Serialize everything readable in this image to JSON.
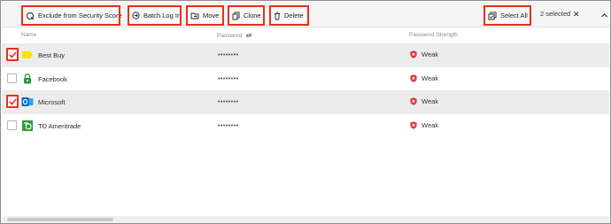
{
  "toolbar": {
    "exclude_label": "Exclude from Security Score",
    "batch_login_label": "Batch Log In",
    "move_label": "Move",
    "clone_label": "Clone",
    "delete_label": "Delete",
    "select_all_label": "Select All",
    "selected_count": "2 selected",
    "close_glyph": "✕"
  },
  "columns": {
    "name": "Name",
    "password": "Password",
    "strength": "Password Strength"
  },
  "rows": [
    {
      "name": "Best Buy",
      "password": "••••••••",
      "strength": "Weak",
      "checked": true,
      "icon": "bestbuy-logo"
    },
    {
      "name": "Facebook",
      "password": "••••••••",
      "strength": "Weak",
      "checked": false,
      "icon": "lock-icon"
    },
    {
      "name": "Microsoft",
      "password": "••••••••",
      "strength": "Weak",
      "checked": true,
      "icon": "outlook-logo"
    },
    {
      "name": "TD Ameritrade",
      "password": "••••••••",
      "strength": "Weak",
      "checked": false,
      "icon": "td-logo"
    }
  ],
  "colors": {
    "highlight": "#e8301c",
    "weak": "#d93a3a",
    "selected_row": "#ececec"
  }
}
